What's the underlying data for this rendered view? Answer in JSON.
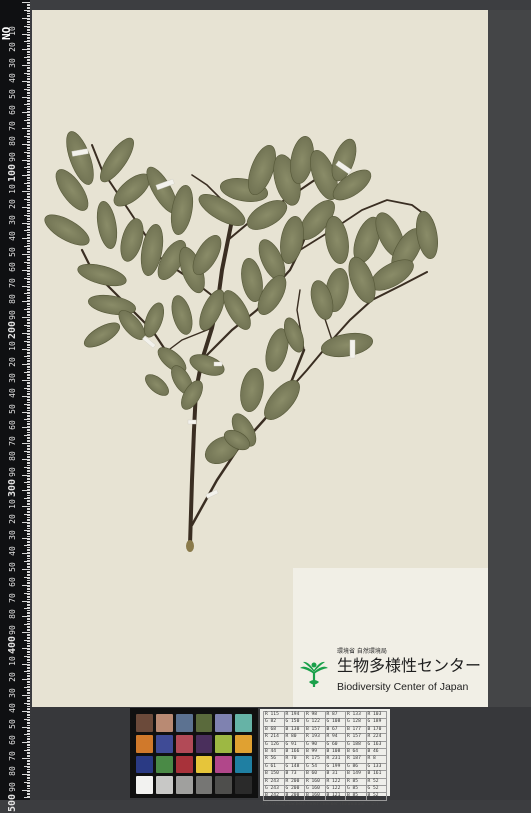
{
  "ruler": {
    "labels": [
      "10",
      "20",
      "30",
      "40",
      "50",
      "60",
      "70",
      "80",
      "90",
      "100",
      "10",
      "20",
      "30",
      "40",
      "50",
      "60",
      "70",
      "80",
      "90",
      "200",
      "10",
      "20",
      "30",
      "40",
      "50",
      "60",
      "70",
      "80",
      "90",
      "300",
      "10",
      "20",
      "30",
      "40",
      "50",
      "60",
      "70",
      "80",
      "90",
      "400",
      "10",
      "20",
      "30",
      "40",
      "50",
      "60",
      "70",
      "80",
      "90",
      "500"
    ],
    "top_marker": "NO"
  },
  "label_card": {
    "ministry": "環境省 自然環境局",
    "center_name_jp": "生物多様性センター",
    "center_name_en": "Biodiversity Center of Japan",
    "brand_color": "#1aa04a"
  },
  "color_checker": {
    "swatches": [
      "#6b4a3a",
      "#b98a73",
      "#5c7291",
      "#5a6a3c",
      "#7f82b0",
      "#66b3a6",
      "#d0792b",
      "#3f4b96",
      "#b24a57",
      "#4a2f5c",
      "#9db843",
      "#e0a131",
      "#2a3a84",
      "#4a8a46",
      "#a8323a",
      "#e6c53a",
      "#b1478a",
      "#1f7fa2",
      "#f2f2f0",
      "#c8c8c6",
      "#a0a09e",
      "#767674",
      "#4e4e4c",
      "#2a2a2a"
    ]
  },
  "color_table": {
    "rows": [
      [
        "R 115",
        "R 194",
        "R 98",
        "R 87",
        "R 133",
        "R 103"
      ],
      [
        "G 82",
        "G 150",
        "G 122",
        "G 108",
        "G 128",
        "G 189"
      ],
      [
        "B 68",
        "B 130",
        "B 157",
        "B 67",
        "B 177",
        "B 170"
      ],
      [
        "R 214",
        "R 80",
        "R 193",
        "R 94",
        "R 157",
        "R 224"
      ],
      [
        "G 126",
        "G 91",
        "G 90",
        "G 60",
        "G 188",
        "G 163"
      ],
      [
        "B 44",
        "B 166",
        "B 99",
        "B 108",
        "B 64",
        "B 46"
      ],
      [
        "R 56",
        "R 70",
        "R 175",
        "R 231",
        "R 187",
        "R 8"
      ],
      [
        "G 61",
        "G 148",
        "G 54",
        "G 199",
        "G 86",
        "G 133"
      ],
      [
        "B 150",
        "B 73",
        "B 60",
        "B 31",
        "B 149",
        "B 161"
      ],
      [
        "R 243",
        "R 200",
        "R 160",
        "R 122",
        "R 85",
        "R 52"
      ],
      [
        "G 243",
        "G 200",
        "G 160",
        "G 122",
        "G 85",
        "G 52"
      ],
      [
        "B 242",
        "B 200",
        "B 160",
        "B 121",
        "B 85",
        "B 52"
      ]
    ],
    "caption": "by GretagMacbeth color checker (Illuminant C 2°)"
  }
}
